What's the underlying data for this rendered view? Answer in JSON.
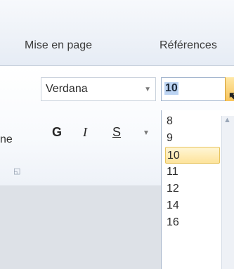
{
  "tabs": {
    "mise_en_page": "Mise en page",
    "references": "Références"
  },
  "font": {
    "name": "Verdana",
    "size": "10"
  },
  "format": {
    "bold": "G",
    "italic": "I",
    "underline": "S"
  },
  "left_fragment": "ne",
  "dropdown": {
    "sizes": [
      "8",
      "9",
      "10",
      "11",
      "12",
      "14",
      "16"
    ],
    "selected": "10"
  },
  "icons": {
    "font_arrow": "chevron-down-icon",
    "size_drop": "dropdown-button-icon",
    "launcher": "dialog-launcher-icon",
    "cursor": "mouse-cursor-icon"
  },
  "colors": {
    "selection_highlight": "#fde39b",
    "text_selection": "#bcd4f3"
  }
}
